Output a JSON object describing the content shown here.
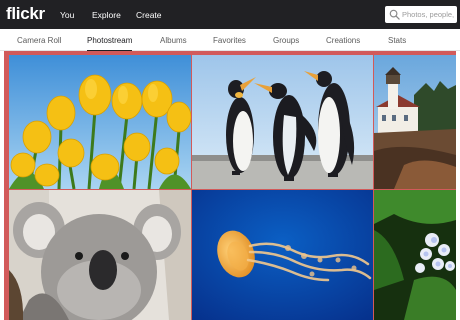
{
  "header": {
    "logo": "flickr",
    "nav": [
      {
        "label": "You"
      },
      {
        "label": "Explore"
      },
      {
        "label": "Create"
      }
    ],
    "search": {
      "placeholder": "Photos, people,",
      "icon": "search-icon"
    }
  },
  "subnav": {
    "active": "Photostream",
    "tabs": [
      {
        "label": "Camera Roll"
      },
      {
        "label": "Photostream"
      },
      {
        "label": "Albums"
      },
      {
        "label": "Favorites"
      },
      {
        "label": "Groups"
      },
      {
        "label": "Creations"
      },
      {
        "label": "Stats"
      }
    ]
  },
  "photos": [
    {
      "subject": "yellow tulips"
    },
    {
      "subject": "penguins"
    },
    {
      "subject": "lighthouse"
    },
    {
      "subject": "koala"
    },
    {
      "subject": "jellyfish"
    },
    {
      "subject": "hydrangea"
    }
  ],
  "colors": {
    "topbar": "#212124",
    "accent_frame": "#d25a5a"
  }
}
